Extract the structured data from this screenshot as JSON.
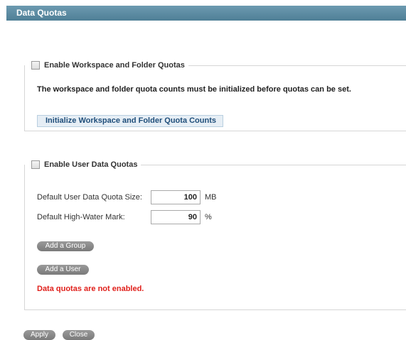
{
  "header": {
    "title": "Data Quotas"
  },
  "workspace_quotas": {
    "legend": "Enable Workspace and Folder Quotas",
    "checked": false,
    "note": "The workspace and folder quota counts must be initialized before quotas can be set.",
    "init_button": "Initialize Workspace and Folder Quota Counts"
  },
  "user_quotas": {
    "legend": "Enable User Data Quotas",
    "checked": false,
    "quota_size_label": "Default User Data Quota Size:",
    "quota_size_value": "100",
    "quota_size_unit": "MB",
    "high_water_label": "Default High-Water Mark:",
    "high_water_value": "90",
    "high_water_unit": "%",
    "add_group_button": "Add a Group",
    "add_user_button": "Add a User",
    "error_text": "Data quotas are not enabled."
  },
  "footer": {
    "apply_button": "Apply",
    "close_button": "Close"
  },
  "colors": {
    "header_bg": "#5b8aa1",
    "error": "#e0201b",
    "button_gray": "#8a8a8a",
    "link_blue": "#1f4e7a"
  }
}
